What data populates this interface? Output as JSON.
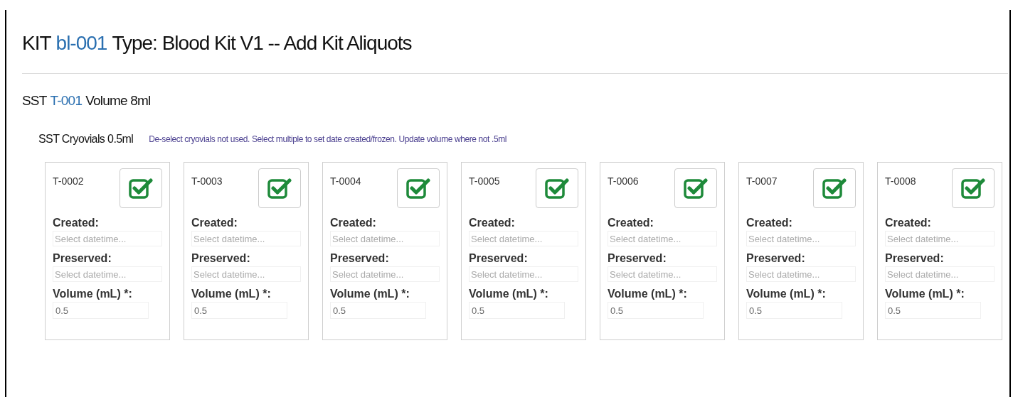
{
  "header": {
    "prefix": "KIT",
    "kit_link": "bl-001",
    "suffix": "Type: Blood Kit V1 -- Add Kit Aliquots"
  },
  "tube": {
    "prefix": "SST",
    "tube_link": "T-001",
    "suffix": "Volume 8ml"
  },
  "aliquot_group": {
    "title": "SST Cryovials 0.5ml",
    "hint": "De-select cryovials not used. Select multiple to set date created/frozen. Update volume where not .5ml"
  },
  "cryovials": [
    {
      "id": "T-0002",
      "checked": true,
      "created_label": "Created:",
      "created_placeholder": "Select datetime...",
      "preserved_label": "Preserved:",
      "preserved_placeholder": "Select datetime...",
      "volume_label": "Volume (mL) *:",
      "volume": "0.5"
    },
    {
      "id": "T-0003",
      "checked": true,
      "created_label": "Created:",
      "created_placeholder": "Select datetime...",
      "preserved_label": "Preserved:",
      "preserved_placeholder": "Select datetime...",
      "volume_label": "Volume (mL) *:",
      "volume": "0.5"
    },
    {
      "id": "T-0004",
      "checked": true,
      "created_label": "Created:",
      "created_placeholder": "Select datetime...",
      "preserved_label": "Preserved:",
      "preserved_placeholder": "Select datetime...",
      "volume_label": "Volume (mL) *:",
      "volume": "0.5"
    },
    {
      "id": "T-0005",
      "checked": true,
      "created_label": "Created:",
      "created_placeholder": "Select datetime...",
      "preserved_label": "Preserved:",
      "preserved_placeholder": "Select datetime...",
      "volume_label": "Volume (mL) *:",
      "volume": "0.5"
    },
    {
      "id": "T-0006",
      "checked": true,
      "created_label": "Created:",
      "created_placeholder": "Select datetime...",
      "preserved_label": "Preserved:",
      "preserved_placeholder": "Select datetime...",
      "volume_label": "Volume (mL) *:",
      "volume": "0.5"
    },
    {
      "id": "T-0007",
      "checked": true,
      "created_label": "Created:",
      "created_placeholder": "Select datetime...",
      "preserved_label": "Preserved:",
      "preserved_placeholder": "Select datetime...",
      "volume_label": "Volume (mL) *:",
      "volume": "0.5"
    },
    {
      "id": "T-0008",
      "checked": true,
      "created_label": "Created:",
      "created_placeholder": "Select datetime...",
      "preserved_label": "Preserved:",
      "preserved_placeholder": "Select datetime...",
      "volume_label": "Volume (mL) *:",
      "volume": "0.5"
    }
  ]
}
